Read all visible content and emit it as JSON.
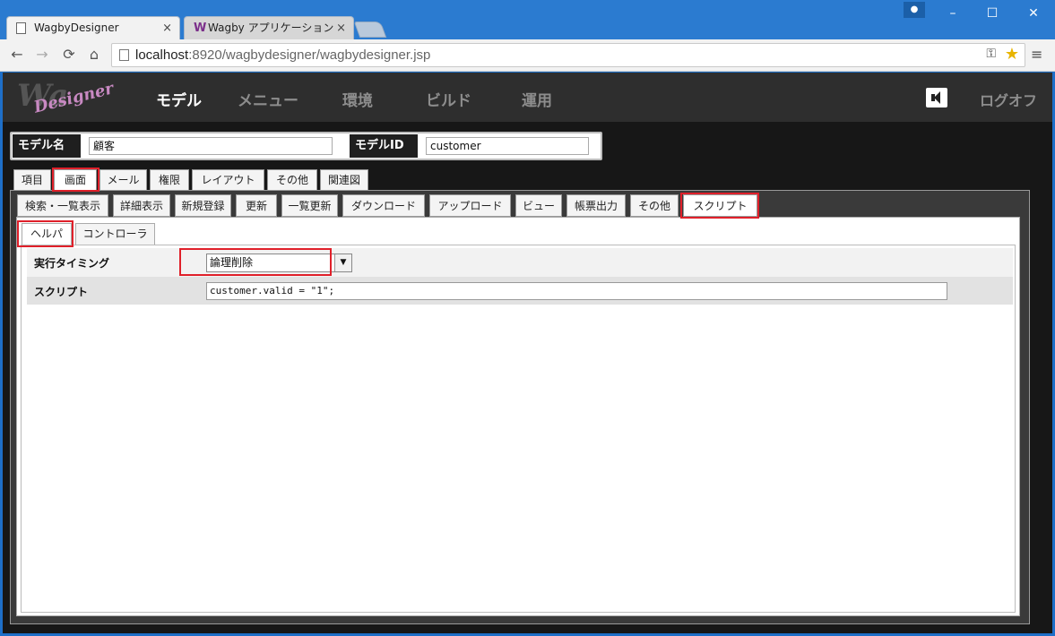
{
  "browser": {
    "tabs": [
      {
        "title": "WagbyDesigner",
        "close": "×"
      },
      {
        "title": "Wagby アプリケーション ログオ",
        "close": "×",
        "icon": "W"
      }
    ],
    "url_host": "localhost",
    "url_path": ":8920/wagbydesigner/wagbydesigner.jsp",
    "nav": {
      "back": "←",
      "forward": "→",
      "reload": "⟳",
      "home": "⌂"
    },
    "window_controls": {
      "minimize": "–",
      "maximize": "☐",
      "close": "✕"
    },
    "menu": "≡"
  },
  "app": {
    "logo": {
      "w": "Wa",
      "d": "Designer"
    },
    "nav": [
      "モデル",
      "メニュー",
      "環境",
      "ビルド",
      "運用"
    ],
    "logoff": "ログオフ"
  },
  "model": {
    "name_label": "モデル名",
    "name_value": "顧客",
    "id_label": "モデルID",
    "id_value": "customer"
  },
  "tabs_level1": [
    "項目",
    "画面",
    "メール",
    "権限",
    "レイアウト",
    "その他",
    "関連図"
  ],
  "tabs_level2": [
    "検索・一覧表示",
    "詳細表示",
    "新規登録",
    "更新",
    "一覧更新",
    "ダウンロード",
    "アップロード",
    "ビュー",
    "帳票出力",
    "その他",
    "スクリプト"
  ],
  "tabs_level3": [
    "ヘルパ",
    "コントローラ"
  ],
  "form": {
    "timing_label": "実行タイミング",
    "timing_value": "論理削除",
    "script_label": "スクリプト",
    "script_value": "customer.valid = \"1\";"
  },
  "colors": {
    "highlight": "#e0202a",
    "app_bg": "#171717",
    "nav_bg": "#2e2e2e"
  }
}
